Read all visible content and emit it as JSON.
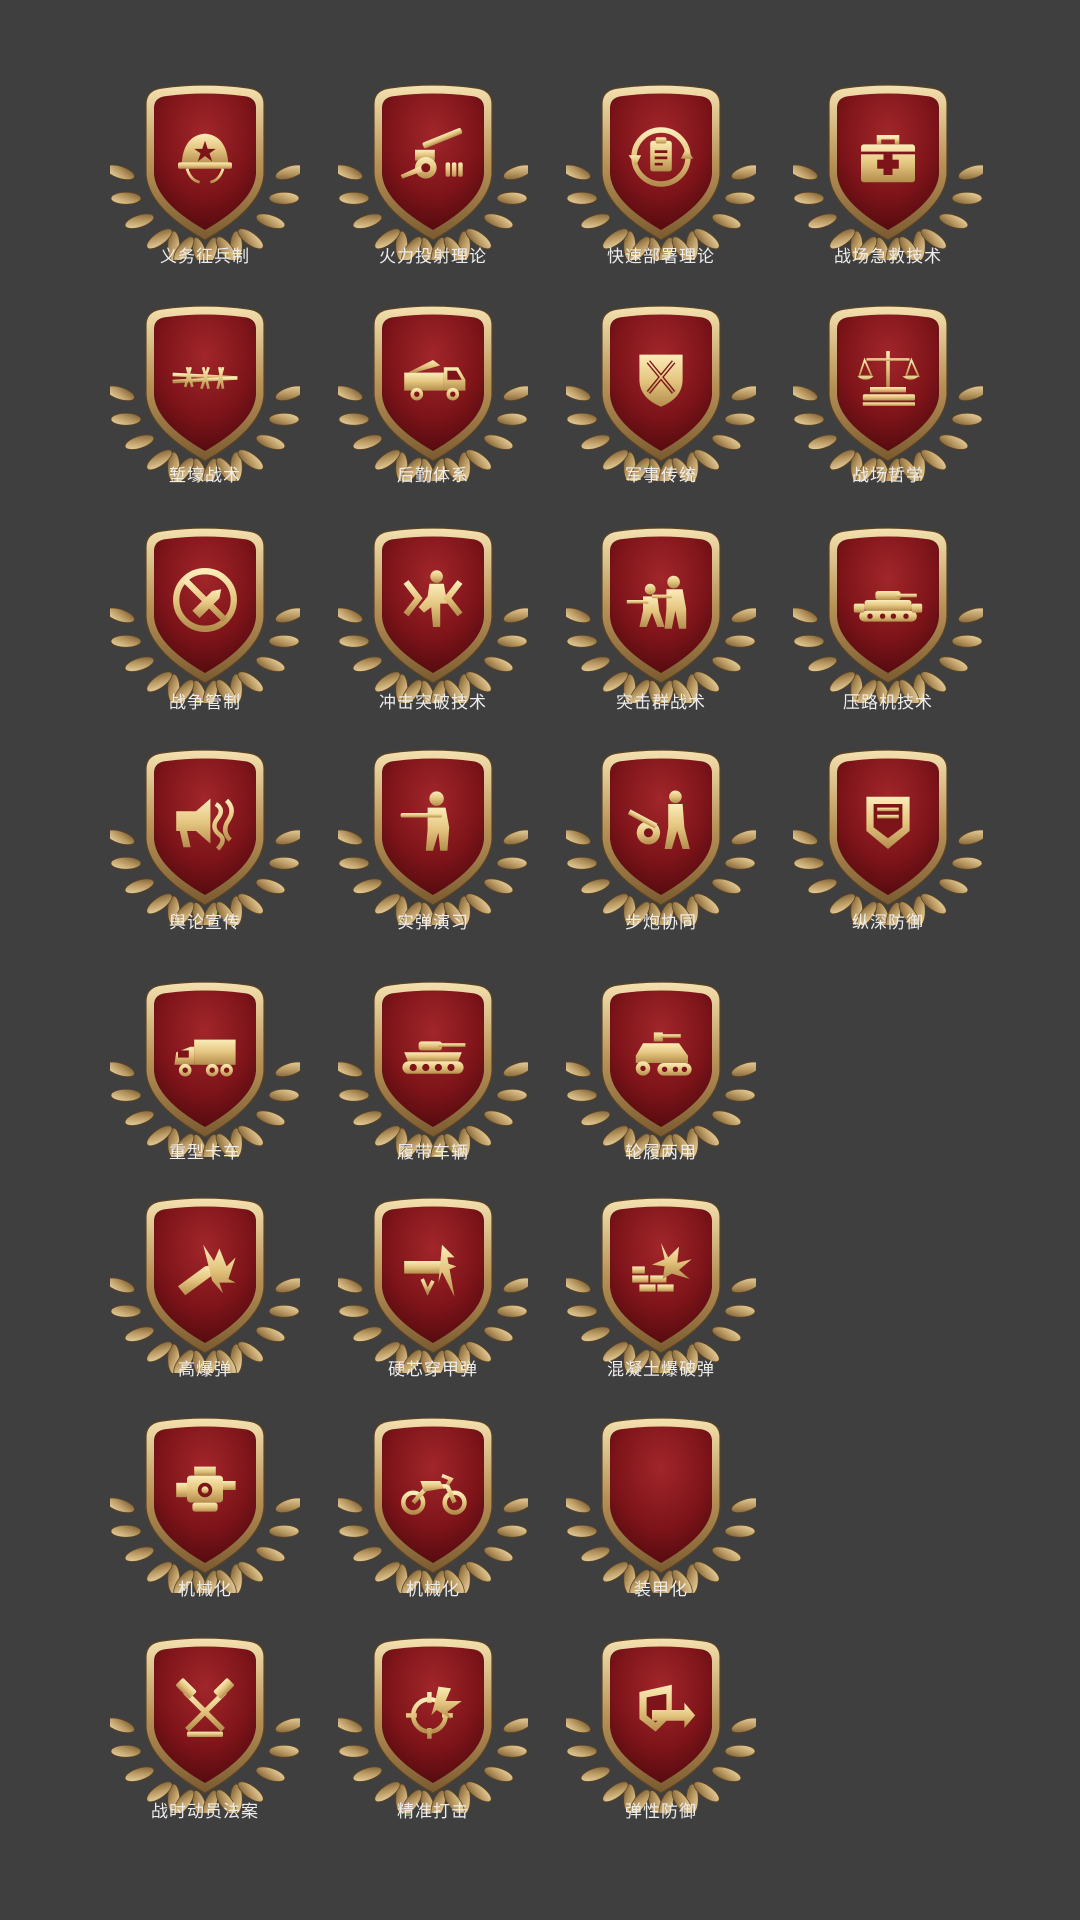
{
  "title": "",
  "colors": {
    "background": "#3f3f40",
    "shield_red": "#7d1419",
    "shield_red_light": "#a1262a",
    "gold": "#e9cf8c",
    "gold_dark": "#8a6a3a",
    "label": "#ececec"
  },
  "badges": [
    {
      "label": "义务征兵制",
      "icon": "helmet-star-icon"
    },
    {
      "label": "火力投射理论",
      "icon": "howitzer-icon"
    },
    {
      "label": "快速部署理论",
      "icon": "clipboard-cycle-icon"
    },
    {
      "label": "战场急救技术",
      "icon": "medical-kit-icon"
    },
    {
      "label": "堑壕战术",
      "icon": "barbed-wire-icon"
    },
    {
      "label": "后勤体系",
      "icon": "supply-truck-icon"
    },
    {
      "label": "军事传统",
      "icon": "crossed-swords-shield-icon"
    },
    {
      "label": "战场哲学",
      "icon": "scales-book-icon"
    },
    {
      "label": "战争管制",
      "icon": "no-shell-icon"
    },
    {
      "label": "冲击突破技术",
      "icon": "breakthrough-soldier-icon"
    },
    {
      "label": "突击群战术",
      "icon": "assault-squad-icon"
    },
    {
      "label": "压路机技术",
      "icon": "tank-formation-icon"
    },
    {
      "label": "舆论宣传",
      "icon": "megaphone-icon"
    },
    {
      "label": "实弹演习",
      "icon": "rifleman-icon"
    },
    {
      "label": "步炮协同",
      "icon": "infantry-artillery-icon"
    },
    {
      "label": "纵深防御",
      "icon": "chevron-shield-icon"
    },
    {
      "label": "重型卡车",
      "icon": "heavy-truck-icon"
    },
    {
      "label": "履带车辆",
      "icon": "tracked-vehicle-icon"
    },
    {
      "label": "轮履两用",
      "icon": "half-track-icon"
    },
    {
      "label": "高爆弹",
      "icon": "high-explosive-shell-icon"
    },
    {
      "label": "硬芯穿甲弹",
      "icon": "armor-piercing-shell-icon"
    },
    {
      "label": "混凝土爆破弹",
      "icon": "concrete-buster-icon"
    },
    {
      "label": "机械化",
      "icon": "engine-icon"
    },
    {
      "label": "机械化",
      "icon": "motorcycle-icon"
    },
    {
      "label": "装甲化",
      "icon": "empty-icon"
    },
    {
      "label": "战时动员法案",
      "icon": "crossed-hammers-icon"
    },
    {
      "label": "精准打击",
      "icon": "crosshair-strike-icon"
    },
    {
      "label": "弹性防御",
      "icon": "elastic-defense-icon"
    }
  ]
}
